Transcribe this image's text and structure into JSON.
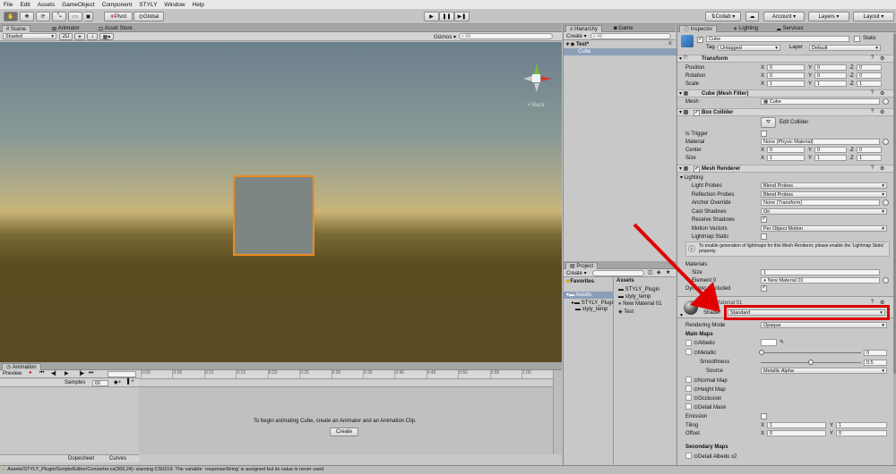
{
  "menu": [
    "File",
    "Edit",
    "Assets",
    "GameObject",
    "Component",
    "STYLY",
    "Window",
    "Help"
  ],
  "toolbar": {
    "pivot": "Pivot",
    "global": "Global",
    "collab": "Collab ▾",
    "account": "Account ▾",
    "layers": "Layers ▾",
    "layout": "Layout ▾"
  },
  "scene": {
    "tabs": [
      "Scene",
      "Animator",
      "Asset Store"
    ],
    "shading": "Shaded",
    "mode_2d": "2D",
    "gizmos": "Gizmos ▾",
    "search_ph": "All",
    "back_label": "< Back",
    "colors": {
      "selection": "#f08a1e",
      "sky_top": "#6b7e8c",
      "ground": "#5c4a20"
    }
  },
  "animation": {
    "tab": "Animation",
    "preview": "Preview",
    "samples_label": "Samples",
    "samples_value": "60",
    "timeline_ticks": [
      "0:00",
      "0:05",
      "0:10",
      "0:15",
      "0:20",
      "0:25",
      "0:30",
      "0:35",
      "0:40",
      "0:45",
      "0:50",
      "0:55",
      "1:00"
    ],
    "message": "To begin animating Cube, create an Animator and an Animation Clip.",
    "create": "Create",
    "dopesheet": "Dopesheet",
    "curves": "Curves"
  },
  "hierarchy": {
    "tabs": [
      "Hierarchy",
      "Game"
    ],
    "create": "Create ▾",
    "search_ph": "All",
    "scene": "Test*",
    "items": [
      "Cube"
    ]
  },
  "project": {
    "tab": "Project",
    "create": "Create ▾",
    "favorites": "Favorites",
    "assets": "Assets",
    "tree": [
      "STYLY_Plugi",
      "styly_temp"
    ],
    "files": [
      "STYLY_Plugin",
      "styly_temp",
      "New Material 01",
      "Test"
    ]
  },
  "inspector": {
    "tabs": [
      "Inspector",
      "Lighting",
      "Services"
    ],
    "object_name": "Cube",
    "static_label": "Static",
    "tag_label": "Tag",
    "tag": "Untagged",
    "layer_label": "Layer",
    "layer": "Default",
    "transform": {
      "title": "Transform",
      "rows": [
        {
          "label": "Position",
          "x": "0",
          "y": "0",
          "z": "0"
        },
        {
          "label": "Rotation",
          "x": "0",
          "y": "0",
          "z": "0"
        },
        {
          "label": "Scale",
          "x": "1",
          "y": "1",
          "z": "1"
        }
      ]
    },
    "mesh_filter": {
      "title": "Cube (Mesh Filter)",
      "label": "Mesh",
      "value": "Cube"
    },
    "box_collider": {
      "title": "Box Collider",
      "edit": "Edit Collider",
      "is_trigger": "Is Trigger",
      "material": "Material",
      "material_value": "None (Physic Material)",
      "center": {
        "label": "Center",
        "x": "0",
        "y": "0",
        "z": "0"
      },
      "size": {
        "label": "Size",
        "x": "1",
        "y": "1",
        "z": "1"
      }
    },
    "mesh_renderer": {
      "title": "Mesh Renderer",
      "lighting": "Lighting",
      "rows": [
        {
          "label": "Light Probes",
          "value": "Blend Probes",
          "kind": "dropdown"
        },
        {
          "label": "Reflection Probes",
          "value": "Blend Probes",
          "kind": "dropdown"
        },
        {
          "label": "Anchor Override",
          "value": "None (Transform)",
          "kind": "field"
        },
        {
          "label": "Cast Shadows",
          "value": "On",
          "kind": "dropdown"
        },
        {
          "label": "Receive Shadows",
          "value": "✓",
          "kind": "check"
        },
        {
          "label": "Motion Vectors",
          "value": "Per Object Motion",
          "kind": "dropdown"
        },
        {
          "label": "Lightmap Static",
          "value": "",
          "kind": "check"
        }
      ],
      "info": "To enable generation of lightmaps for this Mesh Renderer, please enable the 'Lightmap Static' property.",
      "materials": "Materials",
      "size_label": "Size",
      "size_value": "1",
      "element_label": "Element 0",
      "element_value": "New Material 01",
      "dynamic_label": "Dynamic Occluded"
    },
    "material": {
      "name": "New Material 01",
      "shader_label": "Shader",
      "shader": "Standard",
      "rendering_mode_label": "Rendering Mode",
      "rendering_mode": "Opaque",
      "main_maps": "Main Maps",
      "albedo": "Albedo",
      "metallic": "Metallic",
      "metallic_value": "0",
      "smoothness": "Smoothness",
      "smoothness_value": "0.5",
      "source": "Source",
      "source_value": "Metallic Alpha",
      "normal": "Normal Map",
      "height": "Height Map",
      "occlusion": "Occlusion",
      "detail": "Detail Mask",
      "emission": "Emission",
      "tiling": "Tiling",
      "tiling_x": "1",
      "tiling_y": "1",
      "offset": "Offset",
      "offset_x": "0",
      "offset_y": "0",
      "secondary": "Secondary Maps",
      "detail_albedo": "Detail Albedo x2"
    }
  },
  "status": "Assets/STYLY_Plugin/Scripts/Editor/Converter.cs(369,24): warning CS0219: The variable `responseString' is assigned but its value is never used",
  "highlight_color": "#e00000"
}
